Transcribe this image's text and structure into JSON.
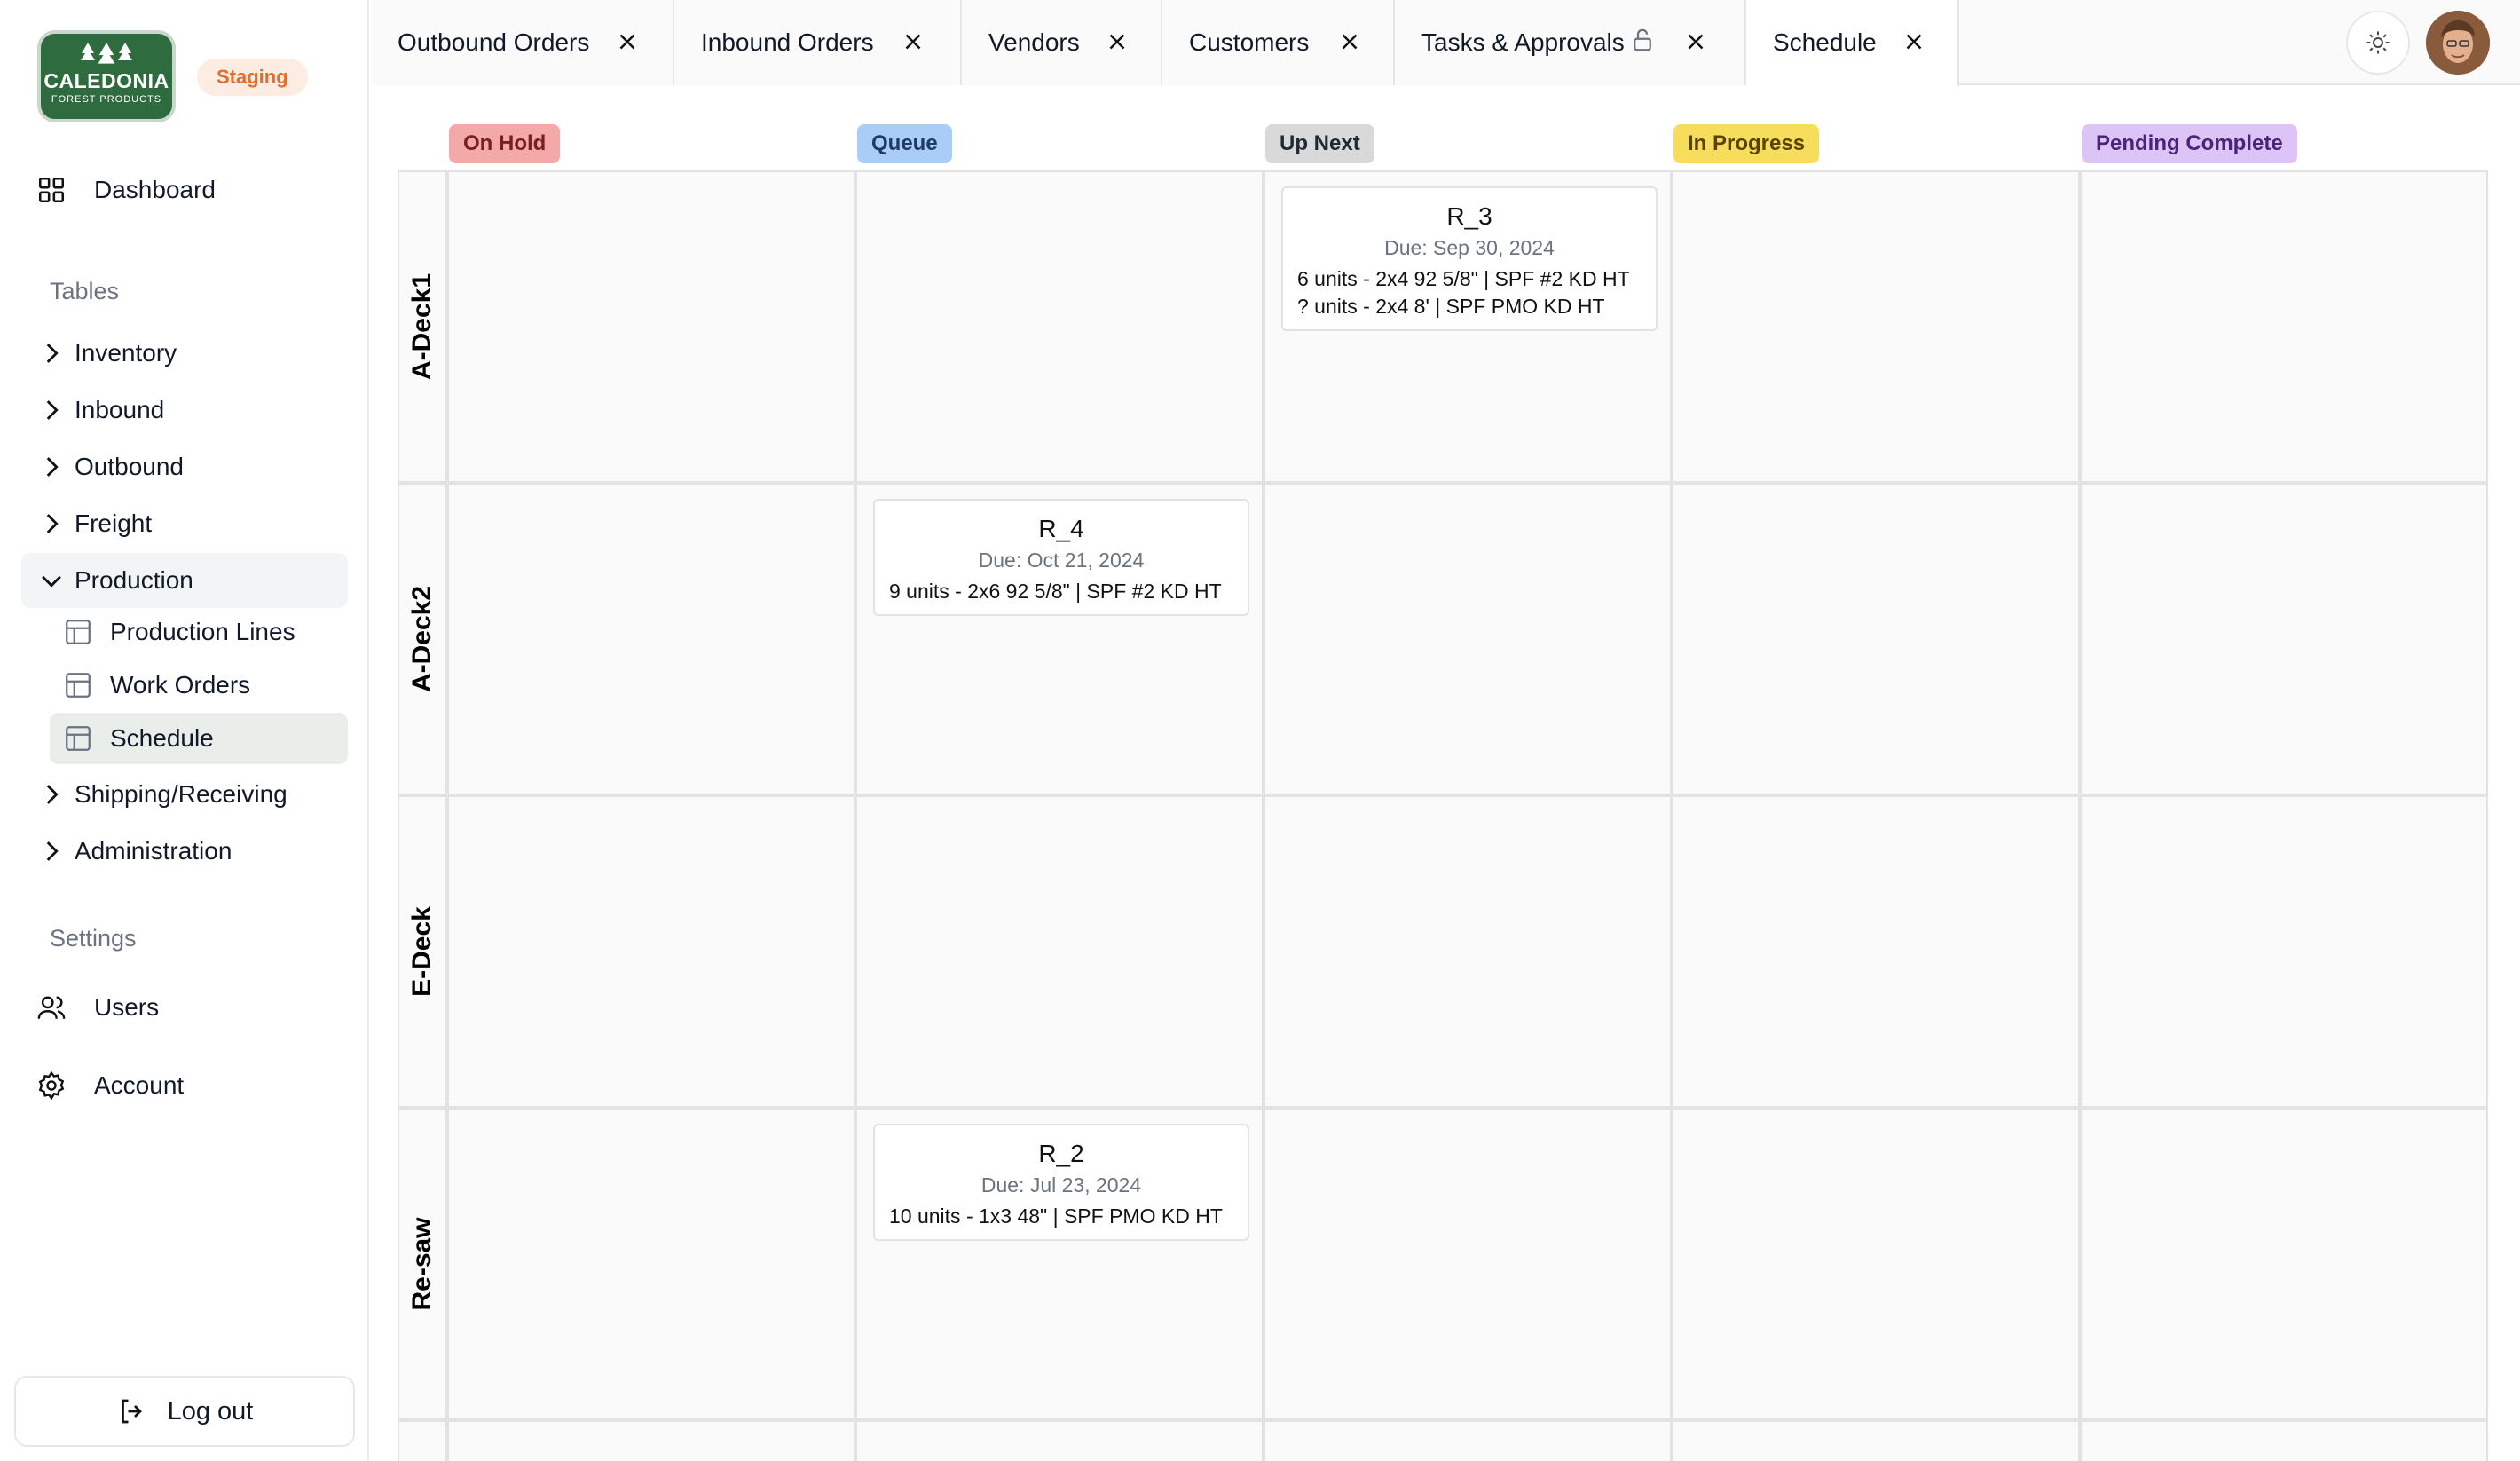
{
  "brand": {
    "logo_name": "CALEDONIA",
    "logo_sub": "FOREST PRODUCTS",
    "env_badge": "Staging"
  },
  "sidebar": {
    "dashboard": "Dashboard",
    "tables_label": "Tables",
    "groups": [
      {
        "label": "Inventory",
        "icon": "chevron-right-icon"
      },
      {
        "label": "Inbound",
        "icon": "chevron-right-icon"
      },
      {
        "label": "Outbound",
        "icon": "chevron-right-icon"
      },
      {
        "label": "Freight",
        "icon": "chevron-right-icon"
      },
      {
        "label": "Production",
        "icon": "chevron-down-icon",
        "expanded": true,
        "children": [
          "Production Lines",
          "Work Orders",
          "Schedule"
        ]
      },
      {
        "label": "Shipping/Receiving",
        "icon": "chevron-right-icon"
      },
      {
        "label": "Administration",
        "icon": "chevron-right-icon"
      }
    ],
    "settings_label": "Settings",
    "users": "Users",
    "account": "Account",
    "logout": "Log out"
  },
  "tabs": [
    {
      "label": "Outbound Orders"
    },
    {
      "label": "Inbound Orders"
    },
    {
      "label": "Vendors"
    },
    {
      "label": "Customers"
    },
    {
      "label": "Tasks & Approvals",
      "locked": true
    },
    {
      "label": "Schedule",
      "active": true
    }
  ],
  "board": {
    "columns": [
      {
        "label": "On Hold",
        "bg": "#f4a9a9",
        "fg": "#7a1f1f"
      },
      {
        "label": "Queue",
        "bg": "#a9cdf6",
        "fg": "#1e3a6b"
      },
      {
        "label": "Up Next",
        "bg": "#d9d9d9",
        "fg": "#1f2937"
      },
      {
        "label": "In Progress",
        "bg": "#f7dd5c",
        "fg": "#5a4300"
      },
      {
        "label": "Pending Complete",
        "bg": "#dcc4f7",
        "fg": "#4b2378"
      }
    ],
    "rows": [
      "A-Deck1",
      "A-Deck2",
      "E-Deck",
      "Re-saw"
    ],
    "cards": [
      {
        "title": "R_3",
        "due": "Due: Sep 30, 2024",
        "lines": [
          "6 units - 2x4 92 5/8\" | SPF #2 KD HT",
          "? units - 2x4 8' | SPF PMO KD HT"
        ]
      },
      {
        "title": "R_4",
        "due": "Due: Oct 21, 2024",
        "lines": [
          "9 units - 2x6 92 5/8\" | SPF #2 KD HT"
        ]
      },
      {
        "title": "R_2",
        "due": "Due: Jul 23, 2024",
        "lines": [
          "10 units - 1x3 48\" | SPF PMO KD HT"
        ]
      }
    ]
  },
  "colors": {
    "brand_green": "#2e6b3f",
    "env_badge": "#e26d2c"
  }
}
